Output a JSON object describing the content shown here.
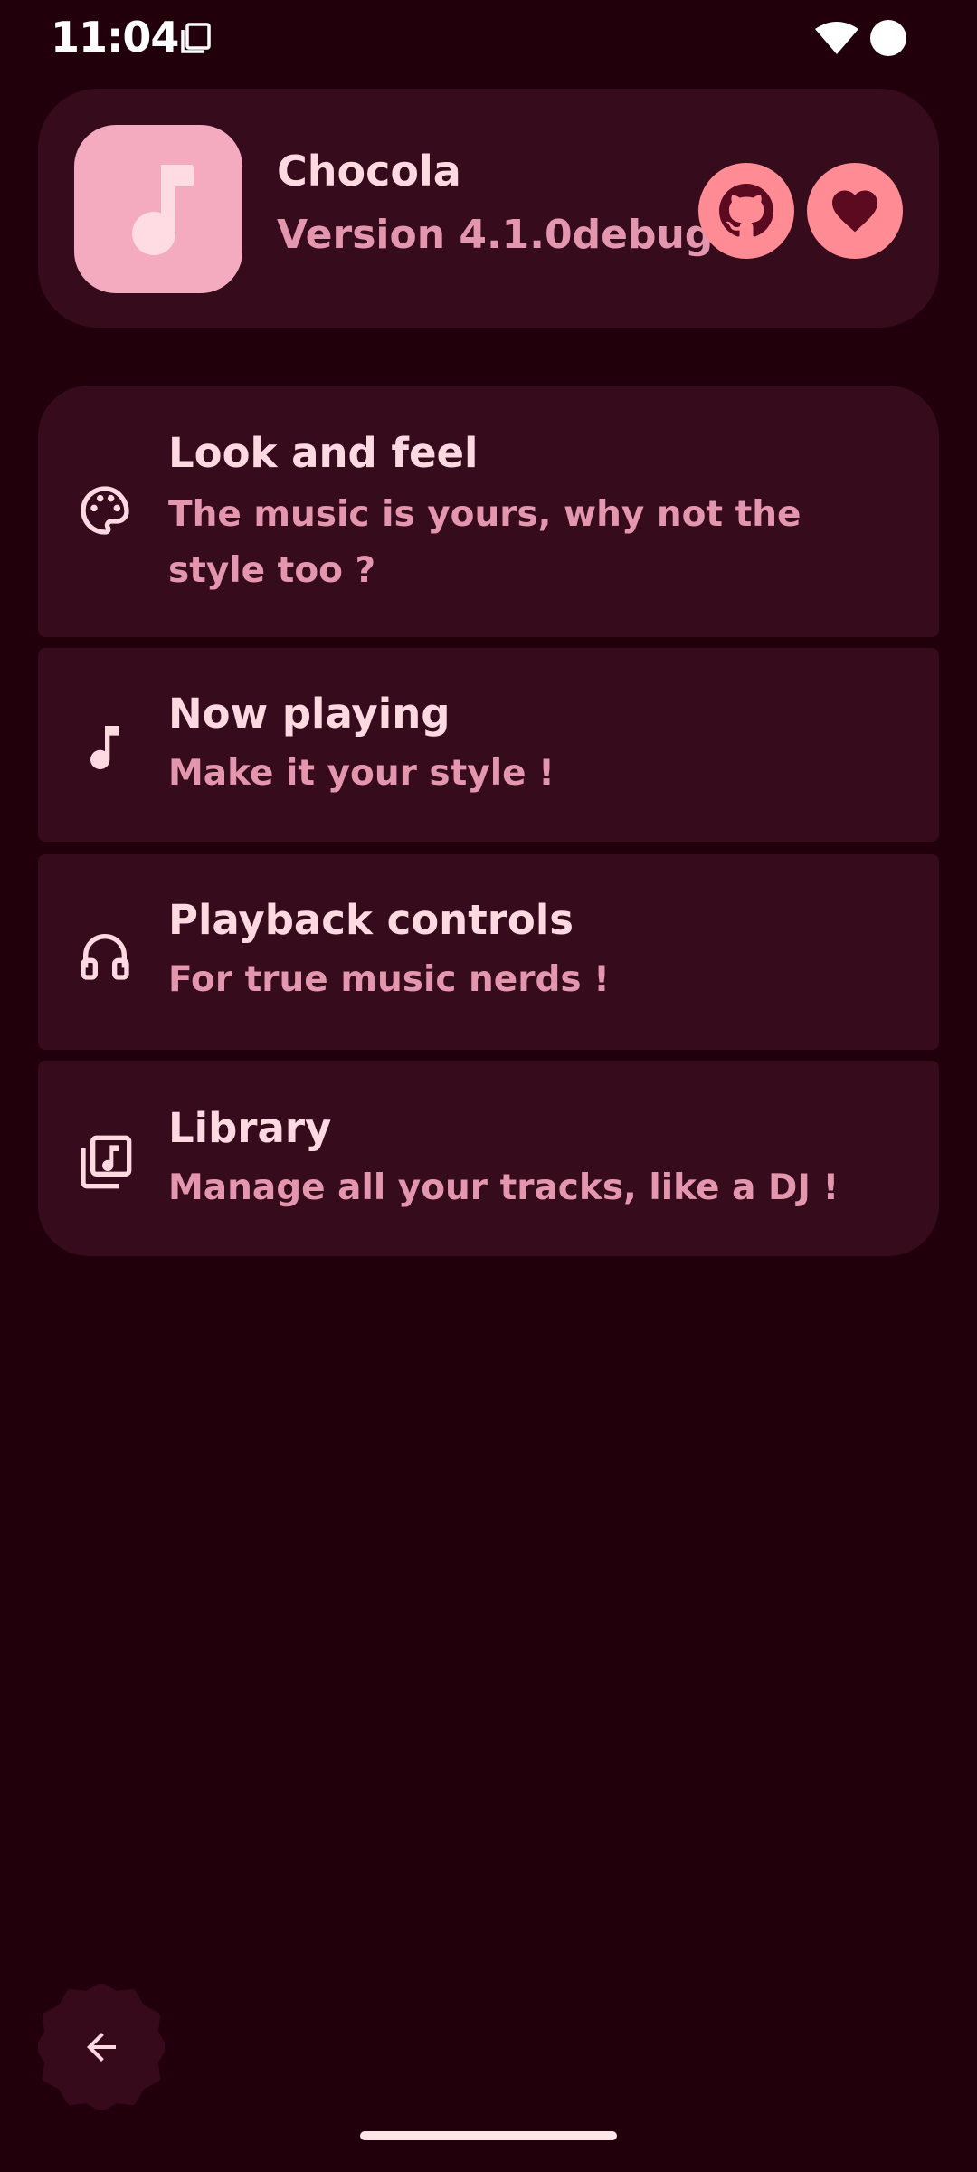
{
  "status_bar": {
    "time": "11:04"
  },
  "about": {
    "app_name": "Chocola",
    "version": "Version 4.1.0debug",
    "icons": {
      "app": "music-note-icon",
      "github": "github-icon",
      "donate": "heart-icon"
    }
  },
  "settings": {
    "items": [
      {
        "title": "Look and feel",
        "description": "The music is yours, why not the style too ?",
        "icon": "palette-icon"
      },
      {
        "title": "Now playing",
        "description": "Make it your style !",
        "icon": "music-note-icon"
      },
      {
        "title": "Playback controls",
        "description": "For true music nerds !",
        "icon": "headphones-icon"
      },
      {
        "title": "Library",
        "description": "Manage all your tracks, like a DJ !",
        "icon": "library-music-icon"
      }
    ]
  },
  "colors": {
    "background": "#21000b",
    "surface": "#360b1c",
    "accent": "#ff8b95",
    "icon_container": "#f4aabf",
    "text_primary": "#ffd9e2",
    "text_secondary": "#e396ae"
  }
}
